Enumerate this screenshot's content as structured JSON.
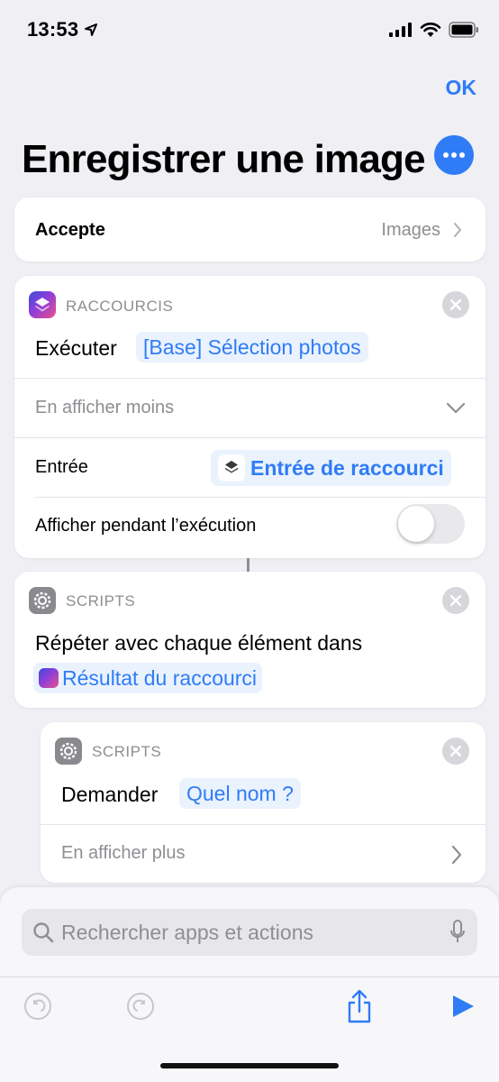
{
  "status_bar": {
    "time": "13:53"
  },
  "nav": {
    "ok_label": "OK"
  },
  "title": "Enregistrer une image",
  "accepts": {
    "label": "Accepte",
    "value": "Images"
  },
  "action1": {
    "category": "RACCOURCIS",
    "verb": "Exécuter",
    "token": "[Base] Sélection photos",
    "show_less": "En afficher moins",
    "input_label": "Entrée",
    "input_token": "Entrée de raccourci",
    "show_while_running": "Afficher pendant l’exécution",
    "toggle_on": false
  },
  "action2": {
    "category": "SCRIPTS",
    "text": "Répéter avec chaque élément dans",
    "token": "Résultat du raccourci"
  },
  "action3": {
    "category": "SCRIPTS",
    "verb": "Demander",
    "token": "Quel nom ?",
    "show_more": "En afficher plus"
  },
  "search": {
    "placeholder": "Rechercher apps et actions"
  },
  "colors": {
    "accent": "#2F7CF6",
    "background": "#EFEFF4"
  }
}
